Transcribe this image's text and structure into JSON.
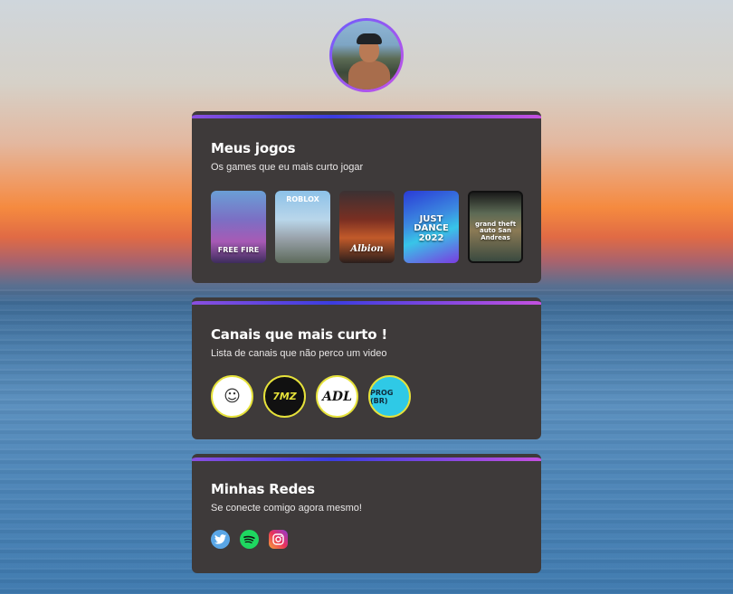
{
  "profile": {
    "avatar_icon": "profile-photo"
  },
  "cards": {
    "games": {
      "title": "Meus jogos",
      "subtitle": "Os games que eu mais curto jogar",
      "items": [
        {
          "label": "FREE FIRE"
        },
        {
          "label": "ROBLOX"
        },
        {
          "label": "Albion"
        },
        {
          "label": "JUST DANCE 2022"
        },
        {
          "label": "grand theft auto San Andreas"
        }
      ]
    },
    "channels": {
      "title": "Canais que mais curto !",
      "subtitle": "Lista de canais que não perco um video",
      "items": [
        {
          "label": "☺"
        },
        {
          "label": "7MZ"
        },
        {
          "label": "ADL"
        },
        {
          "label": "PROG (BR)"
        }
      ]
    },
    "socials": {
      "title": "Minhas Redes",
      "subtitle": "Se conecte comigo agora mesmo!",
      "items": [
        {
          "icon": "twitter-icon",
          "color": "#5aa6e6"
        },
        {
          "icon": "spotify-icon",
          "color": "#1ed760"
        },
        {
          "icon": "instagram-icon",
          "color": "#e8315b"
        }
      ]
    }
  },
  "colors": {
    "card_bg": "#3e3a3a",
    "accent_gradient": [
      "#8a4fe0",
      "#3b3de0",
      "#c451e0"
    ],
    "channel_ring": "#e6e23a"
  }
}
